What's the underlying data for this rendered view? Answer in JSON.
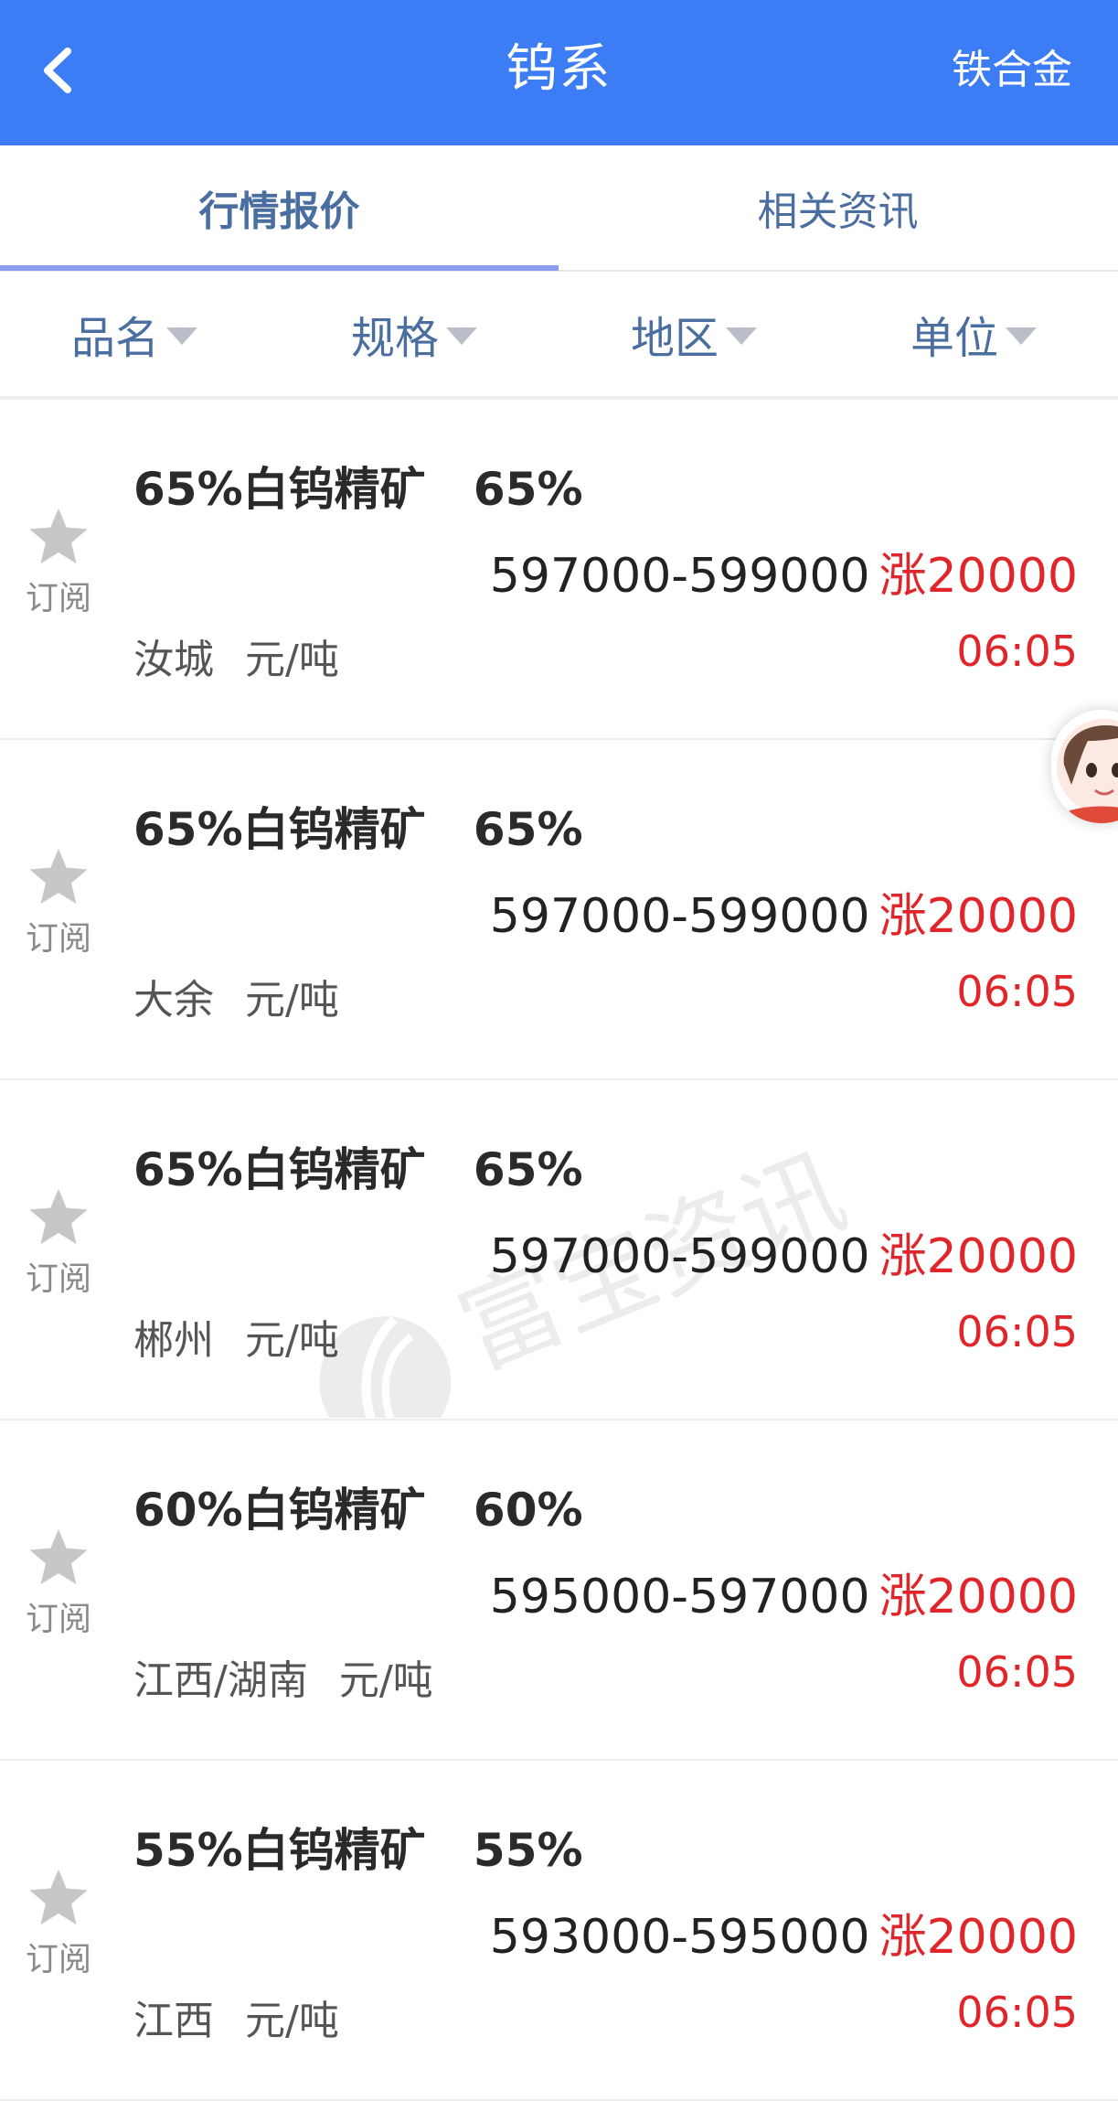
{
  "header": {
    "title": "钨系",
    "action_label": "铁合金",
    "colors": {
      "background": "#3c7cf5",
      "text": "#ffffff"
    }
  },
  "tabs": [
    {
      "label": "行情报价",
      "active": true
    },
    {
      "label": "相关资讯",
      "active": false
    }
  ],
  "filters": [
    {
      "label": "品名"
    },
    {
      "label": "规格"
    },
    {
      "label": "地区"
    },
    {
      "label": "单位"
    }
  ],
  "list": {
    "subscribe_label": "订阅",
    "items": [
      {
        "product": "65%白钨精矿",
        "spec": "65%",
        "range": "597000-599000",
        "change": "涨20000",
        "region": "汝城",
        "unit": "元/吨",
        "time": "06:05"
      },
      {
        "product": "65%白钨精矿",
        "spec": "65%",
        "range": "597000-599000",
        "change": "涨20000",
        "region": "大余",
        "unit": "元/吨",
        "time": "06:05"
      },
      {
        "product": "65%白钨精矿",
        "spec": "65%",
        "range": "597000-599000",
        "change": "涨20000",
        "region": "郴州",
        "unit": "元/吨",
        "time": "06:05"
      },
      {
        "product": "60%白钨精矿",
        "spec": "60%",
        "range": "595000-597000",
        "change": "涨20000",
        "region": "江西/湖南",
        "unit": "元/吨",
        "time": "06:05"
      },
      {
        "product": "55%白钨精矿",
        "spec": "55%",
        "range": "593000-595000",
        "change": "涨20000",
        "region": "江西",
        "unit": "元/吨",
        "time": "06:05"
      }
    ]
  },
  "watermark": {
    "text": "富宝资讯"
  },
  "colors": {
    "up": "#e0262b",
    "tab_text": "#4b6ea0",
    "star": "#c7c7c7"
  },
  "icons": [
    "chevron-left-icon",
    "caret-down-icon",
    "star-icon",
    "assistant-avatar"
  ]
}
